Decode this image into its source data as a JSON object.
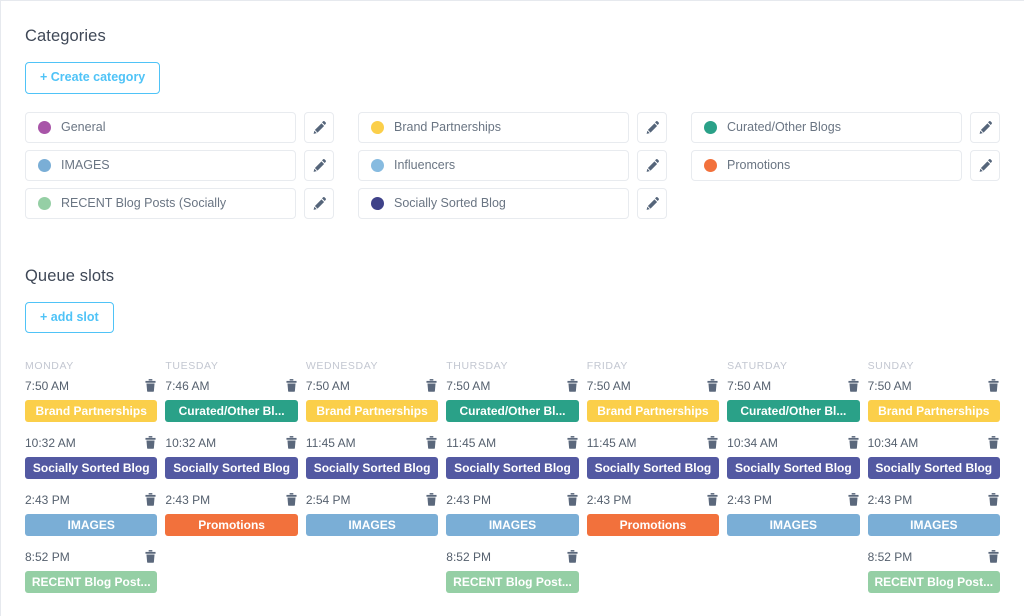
{
  "categories_section": {
    "title": "Categories",
    "create_button": "+ Create category",
    "edit_icon": "pencil-icon",
    "items": [
      {
        "name": "General",
        "color": "#a855a8"
      },
      {
        "name": "Brand Partnerships",
        "color": "#fbcf4a"
      },
      {
        "name": "Curated/Other Blogs",
        "color": "#2aa188"
      },
      {
        "name": "IMAGES",
        "color": "#7aaed6"
      },
      {
        "name": "Influencers",
        "color": "#87bbe0"
      },
      {
        "name": "Promotions",
        "color": "#f2713c"
      },
      {
        "name": "RECENT Blog Posts (Socially",
        "color": "#95cfa5"
      },
      {
        "name": "Socially Sorted Blog",
        "color": "#3f4289"
      }
    ]
  },
  "queue_section": {
    "title": "Queue slots",
    "add_button": "+ add slot",
    "delete_icon": "trash-icon",
    "days": [
      {
        "name": "MONDAY",
        "slots": [
          {
            "time": "7:50 AM",
            "category": "Brand Partnerships",
            "color": "#fbcf4a"
          },
          {
            "time": "10:32 AM",
            "category": "Socially Sorted Blog",
            "color": "#5359a2"
          },
          {
            "time": "2:43 PM",
            "category": "IMAGES",
            "color": "#7aaed6"
          },
          {
            "time": "8:52 PM",
            "category": "RECENT Blog Post...",
            "color": "#95cfa5"
          }
        ]
      },
      {
        "name": "TUESDAY",
        "slots": [
          {
            "time": "7:46 AM",
            "category": "Curated/Other Bl...",
            "color": "#2aa188"
          },
          {
            "time": "10:32 AM",
            "category": "Socially Sorted Blog",
            "color": "#5359a2"
          },
          {
            "time": "2:43 PM",
            "category": "Promotions",
            "color": "#f2713c"
          },
          {
            "time": "",
            "category": "",
            "color": ""
          }
        ]
      },
      {
        "name": "WEDNESDAY",
        "slots": [
          {
            "time": "7:50 AM",
            "category": "Brand Partnerships",
            "color": "#fbcf4a"
          },
          {
            "time": "11:45 AM",
            "category": "Socially Sorted Blog",
            "color": "#5359a2"
          },
          {
            "time": "2:54 PM",
            "category": "IMAGES",
            "color": "#7aaed6"
          },
          {
            "time": "",
            "category": "",
            "color": ""
          }
        ]
      },
      {
        "name": "THURSDAY",
        "slots": [
          {
            "time": "7:50 AM",
            "category": "Curated/Other Bl...",
            "color": "#2aa188"
          },
          {
            "time": "11:45 AM",
            "category": "Socially Sorted Blog",
            "color": "#5359a2"
          },
          {
            "time": "2:43 PM",
            "category": "IMAGES",
            "color": "#7aaed6"
          },
          {
            "time": "8:52 PM",
            "category": "RECENT Blog Post...",
            "color": "#95cfa5"
          }
        ]
      },
      {
        "name": "FRIDAY",
        "slots": [
          {
            "time": "7:50 AM",
            "category": "Brand Partnerships",
            "color": "#fbcf4a"
          },
          {
            "time": "11:45 AM",
            "category": "Socially Sorted Blog",
            "color": "#5359a2"
          },
          {
            "time": "2:43 PM",
            "category": "Promotions",
            "color": "#f2713c"
          },
          {
            "time": "",
            "category": "",
            "color": ""
          }
        ]
      },
      {
        "name": "SATURDAY",
        "slots": [
          {
            "time": "7:50 AM",
            "category": "Curated/Other Bl...",
            "color": "#2aa188"
          },
          {
            "time": "10:34 AM",
            "category": "Socially Sorted Blog",
            "color": "#5359a2"
          },
          {
            "time": "2:43 PM",
            "category": "IMAGES",
            "color": "#7aaed6"
          },
          {
            "time": "",
            "category": "",
            "color": ""
          }
        ]
      },
      {
        "name": "SUNDAY",
        "slots": [
          {
            "time": "7:50 AM",
            "category": "Brand Partnerships",
            "color": "#fbcf4a"
          },
          {
            "time": "10:34 AM",
            "category": "Socially Sorted Blog",
            "color": "#5359a2"
          },
          {
            "time": "2:43 PM",
            "category": "IMAGES",
            "color": "#7aaed6"
          },
          {
            "time": "8:52 PM",
            "category": "RECENT Blog Post...",
            "color": "#95cfa5"
          }
        ]
      }
    ]
  }
}
